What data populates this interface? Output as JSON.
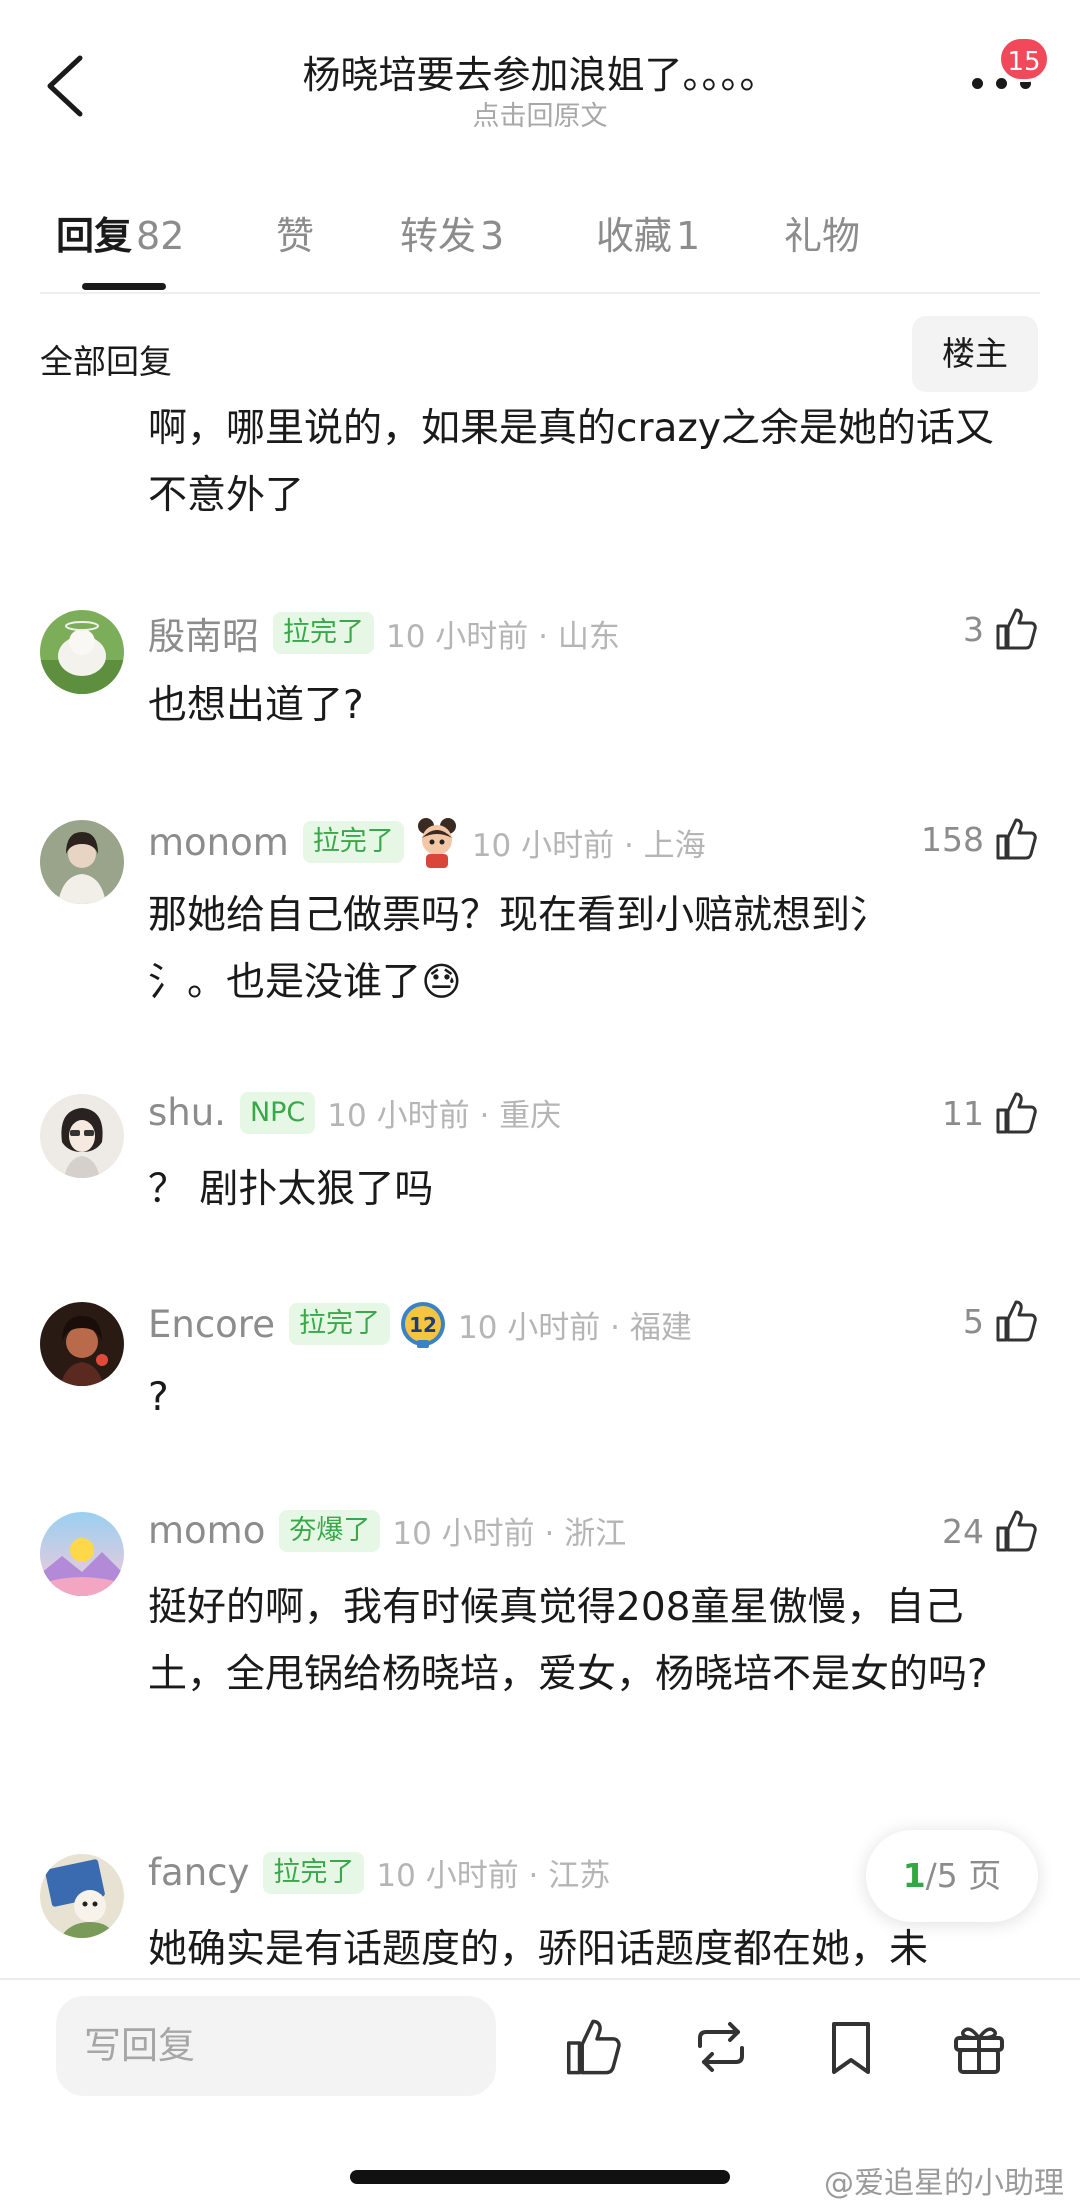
{
  "header": {
    "title": "杨晓培要去参加浪姐了。。。。",
    "subtitle": "点击回原文",
    "notification_count": "15"
  },
  "tabs": [
    {
      "label": "回复",
      "count": "82"
    },
    {
      "label": "赞",
      "count": ""
    },
    {
      "label": "转发",
      "count": "3"
    },
    {
      "label": "收藏",
      "count": "1"
    },
    {
      "label": "礼物",
      "count": ""
    }
  ],
  "filter": {
    "label": "全部回复",
    "op_button": "楼主"
  },
  "partial_comment": {
    "text": "啊，哪里说的，如果是真的crazy之余是她的话又不意外了"
  },
  "comments": [
    {
      "user": "殷南昭",
      "badge": "拉完了",
      "time": "10 小时前 · 山东",
      "likes": "3",
      "text": "也想出道了?"
    },
    {
      "user": "monom",
      "badge": "拉完了",
      "time": "10 小时前 · 上海",
      "likes": "158",
      "text": "那她给自己做票吗？现在看到小赔就想到氵氵。也是没谁了😓"
    },
    {
      "user": "shu.",
      "badge": "NPC",
      "time": "10 小时前 · 重庆",
      "likes": "11",
      "text": "？ 剧扑太狠了吗"
    },
    {
      "user": "Encore",
      "badge": "拉完了",
      "time": "10 小时前 · 福建",
      "likes": "5",
      "text": "?"
    },
    {
      "user": "momo",
      "badge": "夯爆了",
      "time": "10 小时前 · 浙江",
      "likes": "24",
      "text": "挺好的啊，我有时候真觉得208童星傲慢，自己土，全甩锅给杨晓培，爱女，杨晓培不是女的吗?"
    },
    {
      "user": "fancy",
      "badge": "拉完了",
      "time": "10 小时前 · 江苏",
      "likes": "",
      "text": "她确实是有话题度的，骄阳话题度都在她，未"
    }
  ],
  "pagination": {
    "current": "1",
    "total_text": "/5 页"
  },
  "bottom_bar": {
    "reply_placeholder": "写回复"
  },
  "watermark": "@爱追星的小助理",
  "colors": {
    "badge_bg": "#e7f7e5",
    "badge_text": "#3aa84a",
    "notif_badge": "#f2495a",
    "page_current": "#2fa845"
  }
}
